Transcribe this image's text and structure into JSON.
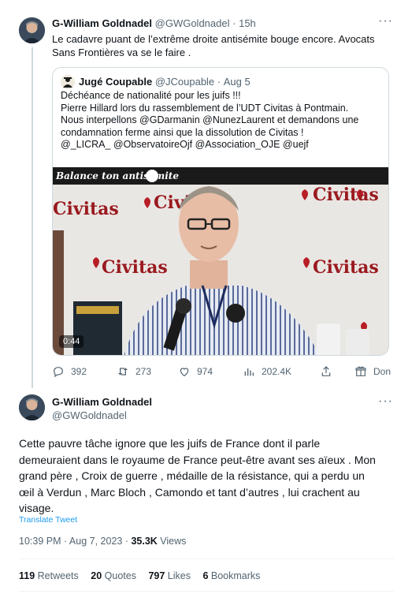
{
  "tweet1": {
    "name": "G-William Goldnadel",
    "handle": "@GWGoldnadel",
    "sep": "·",
    "time": "15h",
    "text_line1": "Le cadavre puant de l’extrême droite antisémite bouge encore. Avocats",
    "text_line2": "Sans Frontières va se le faire .",
    "quote": {
      "name": "Jugé Coupable",
      "handle": "@JCoupable",
      "sep": "·",
      "date": "Aug 5",
      "lines": [
        "Déchéance de nationalité pour les juifs !!!",
        "Pierre Hillard lors du rassemblement de l’UDT Civitas à Pontmain.",
        "Nous interpellons  @GDarmanin @NunezLaurent et demandons une",
        "condamnation ferme ainsi que la dissolution de Civitas !",
        "@_LICRA_ @ObservatoireOjf @Association_OJE @uejf"
      ],
      "video_overlay": "Balance ton antisemite",
      "video_time": "0:44",
      "civitas_label": "Civitas"
    },
    "actions": {
      "replies": "392",
      "retweets": "273",
      "likes": "974",
      "views": "202.4K",
      "donate": "Don"
    }
  },
  "tweet2": {
    "name": "G-William Goldnadel",
    "handle": "@GWGoldnadel",
    "text_lines": [
      "Cette pauvre tâche ignore que les juifs de France dont il parle",
      "demeuraient dans le royaume de France peut-être avant ses aïeux . Mon",
      "grand père , Croix de guerre , médaille de la résistance, qui a perdu un",
      "œil à Verdun , Marc Bloch , Camondo et tant d’autres , lui crachent au",
      "visage."
    ],
    "translate": "Translate Tweet",
    "timestamp": "10:39 PM · Aug 7, 2023 · ",
    "views_count": "35.3K",
    "views_label": " Views",
    "stats": {
      "retweets_count": "119",
      "retweets_label": "Retweets",
      "quotes_count": "20",
      "quotes_label": "Quotes",
      "likes_count": "797",
      "likes_label": "Likes",
      "bookmarks_count": "6",
      "bookmarks_label": "Bookmarks"
    }
  },
  "colors": {
    "text": "#0f1419",
    "muted": "#536471",
    "link": "#1d9bf0",
    "border": "#cfd9de"
  }
}
